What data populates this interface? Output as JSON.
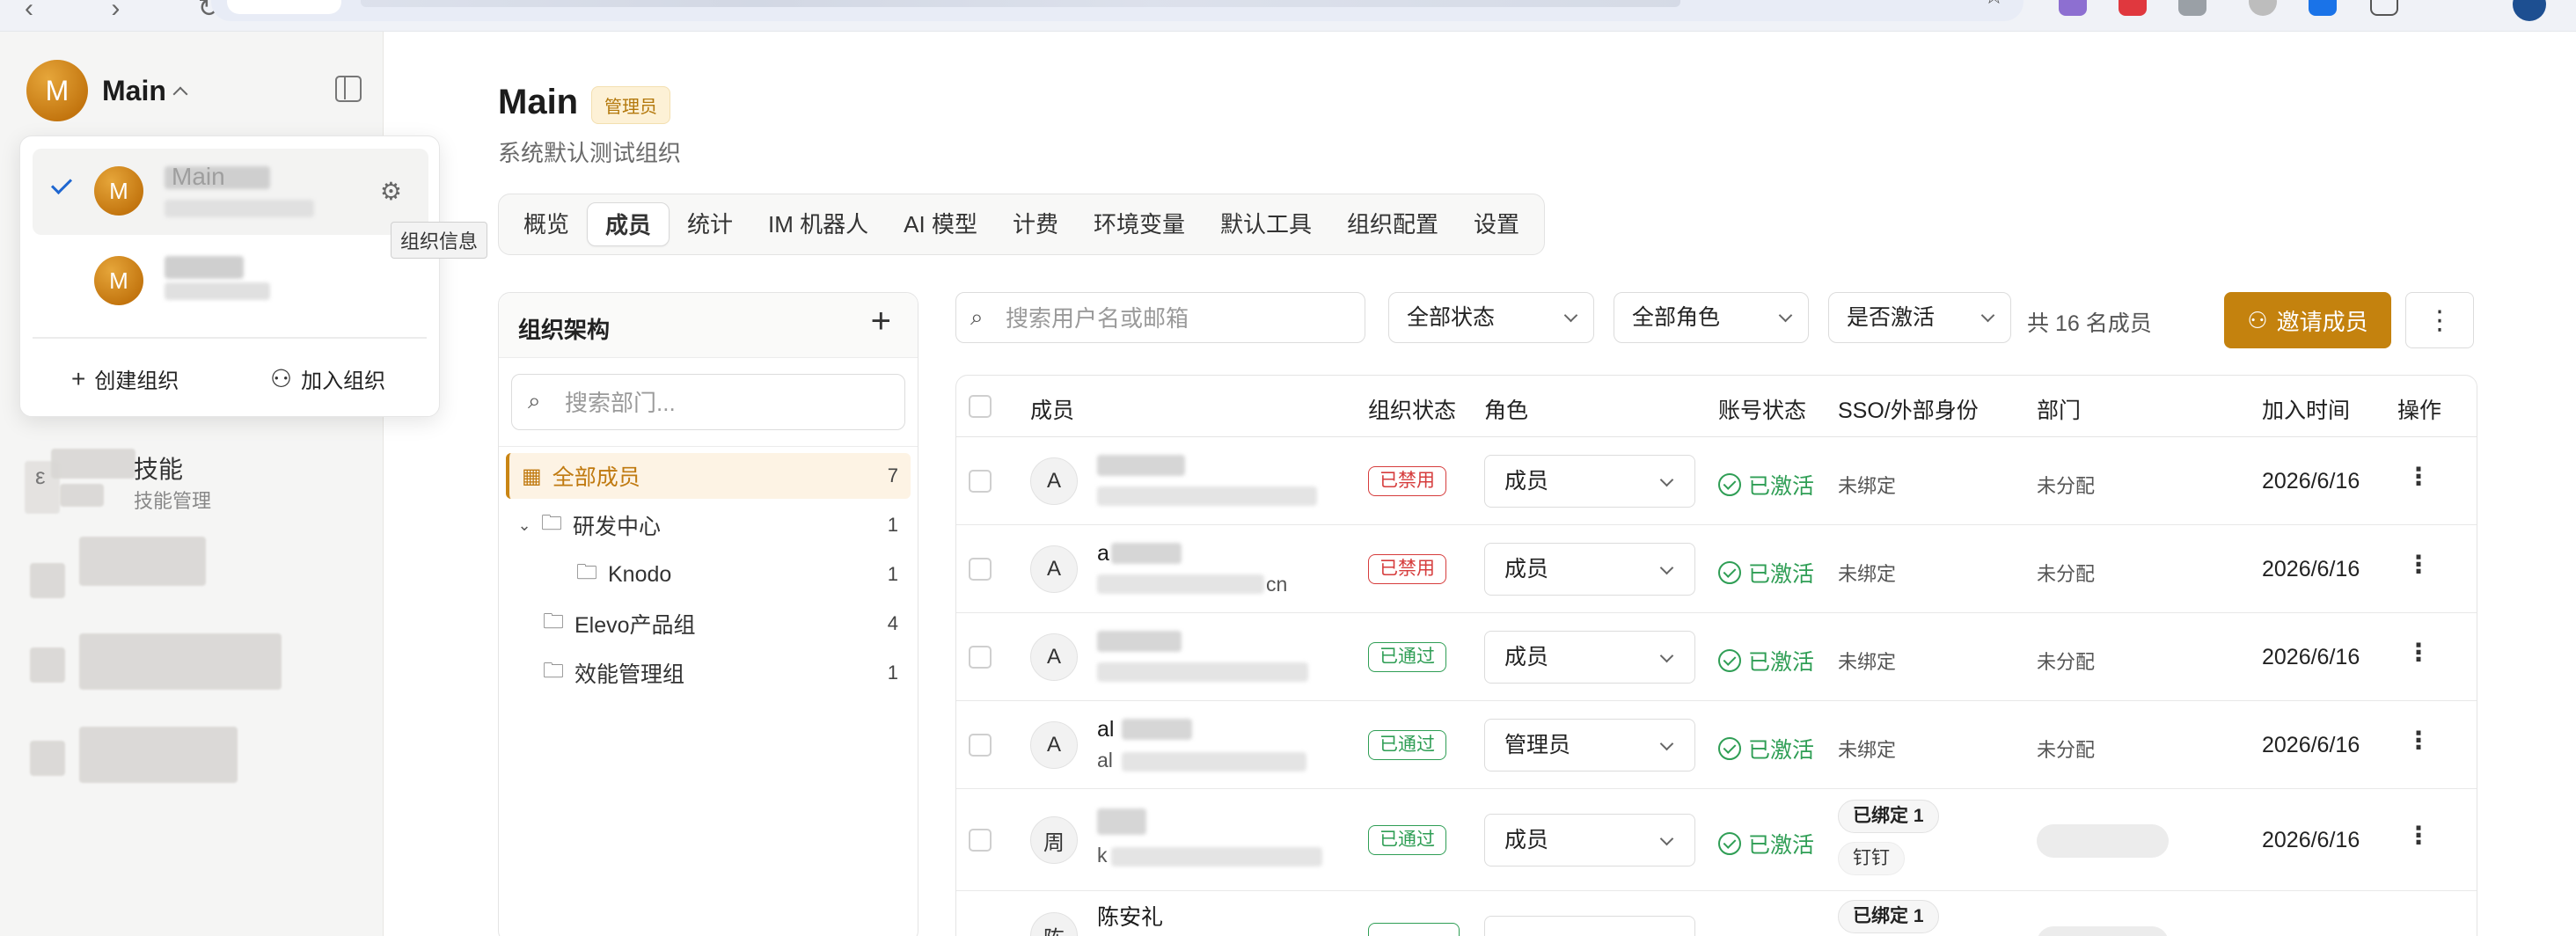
{
  "sidebar": {
    "org_name": "Main",
    "avatar_letter": "M",
    "skill_title": "技能",
    "skill_sub": "技能管理"
  },
  "org_popover": {
    "active_org_label": "Main",
    "gear_tooltip": "组织信息",
    "create_org": "创建组织",
    "join_org": "加入组织"
  },
  "header": {
    "title": "Main",
    "role_badge": "管理员",
    "subtitle": "系统默认测试组织"
  },
  "tabs": [
    {
      "label": "概览"
    },
    {
      "label": "成员"
    },
    {
      "label": "统计"
    },
    {
      "label": "IM 机器人"
    },
    {
      "label": "AI 模型"
    },
    {
      "label": "计费"
    },
    {
      "label": "环境变量"
    },
    {
      "label": "默认工具"
    },
    {
      "label": "组织配置"
    },
    {
      "label": "设置"
    }
  ],
  "active_tab": "成员",
  "tree": {
    "title": "组织架构",
    "search_placeholder": "搜索部门...",
    "nodes": [
      {
        "label": "全部成员",
        "count": "7"
      },
      {
        "label": "研发中心",
        "count": "1"
      },
      {
        "label": "Knodo",
        "count": "1"
      },
      {
        "label": "Elevo产品组",
        "count": "4"
      },
      {
        "label": "效能管理组",
        "count": "1"
      }
    ]
  },
  "filters": {
    "search_placeholder": "搜索用户名或邮箱",
    "status": "全部状态",
    "role": "全部角色",
    "activation": "是否激活",
    "total": "共 16 名成员",
    "invite_button": "邀请成员"
  },
  "table": {
    "headers": {
      "member": "成员",
      "org_status": "组织状态",
      "role": "角色",
      "account_status": "账号状态",
      "sso": "SSO/外部身份",
      "dept": "部门",
      "join_time": "加入时间",
      "actions": "操作"
    },
    "rows": [
      {
        "avatar": "A",
        "name_partial": "",
        "email_partial": "",
        "org_status": "已禁用",
        "role": "成员",
        "account_status": "已激活",
        "sso": "未绑定",
        "dept": "未分配",
        "join_date": "2026/6/16"
      },
      {
        "avatar": "A",
        "name_partial": "a",
        "email_partial": "cn",
        "org_status": "已禁用",
        "role": "成员",
        "account_status": "已激活",
        "sso": "未绑定",
        "dept": "未分配",
        "join_date": "2026/6/16"
      },
      {
        "avatar": "A",
        "name_partial": "",
        "email_partial": "",
        "org_status": "已通过",
        "role": "成员",
        "account_status": "已激活",
        "sso": "未绑定",
        "dept": "未分配",
        "join_date": "2026/6/16"
      },
      {
        "avatar": "A",
        "name_partial": "al",
        "email_partial": "al",
        "org_status": "已通过",
        "role": "管理员",
        "account_status": "已激活",
        "sso": "未绑定",
        "dept": "未分配",
        "join_date": "2026/6/16"
      },
      {
        "avatar": "周",
        "name_partial": "",
        "email_partial": "k",
        "org_status": "已通过",
        "role": "成员",
        "account_status": "已激活",
        "sso": "已绑定 1",
        "sso_provider": "钉钉",
        "dept": "",
        "join_date": "2026/6/16"
      },
      {
        "avatar": "陈",
        "name_partial": "陈安礼",
        "email_partial": "",
        "org_status": "",
        "role": "",
        "account_status": "",
        "sso": "已绑定 1",
        "dept": "",
        "join_date": ""
      }
    ]
  }
}
